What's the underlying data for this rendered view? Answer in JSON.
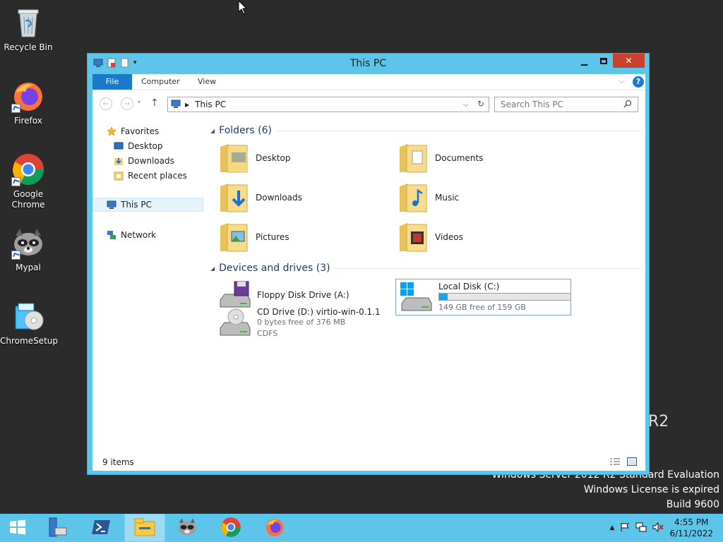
{
  "desktop": {
    "icons": [
      {
        "label": "Recycle Bin"
      },
      {
        "label": "Firefox"
      },
      {
        "label": "Google Chrome"
      },
      {
        "label": "Mypal"
      },
      {
        "label": "ChromeSetup"
      }
    ],
    "watermark": {
      "r2": "R2",
      "edition": "Windows Server 2012 R2 Standard Evaluation",
      "license": "Windows License is expired",
      "build": "Build 9600"
    }
  },
  "window": {
    "title": "This PC",
    "ribbon_tabs": [
      "File",
      "Computer",
      "View"
    ],
    "address": {
      "path": "This PC"
    },
    "search": {
      "placeholder": "Search This PC"
    },
    "nav_pane": {
      "favorites": "Favorites",
      "fav_items": [
        "Desktop",
        "Downloads",
        "Recent places"
      ],
      "this_pc": "This PC",
      "network": "Network"
    },
    "folders_group": "Folders (6)",
    "folders": [
      "Desktop",
      "Documents",
      "Downloads",
      "Music",
      "Pictures",
      "Videos"
    ],
    "drives_group": "Devices and drives (3)",
    "drives": {
      "floppy": {
        "name": "Floppy Disk Drive (A:)"
      },
      "local": {
        "name": "Local Disk (C:)",
        "free": "149 GB free of 159 GB",
        "used_fraction": 0.063
      },
      "cd": {
        "name": "CD Drive (D:) virtio-win-0.1.1",
        "free": "0 bytes free of 376 MB",
        "fs": "CDFS"
      }
    },
    "status": "9 items"
  },
  "taskbar": {
    "clock_time": "4:55 PM",
    "clock_date": "6/11/2022"
  },
  "colors": {
    "accent": "#5ec5ea",
    "file_tab": "#1979ca",
    "close": "#c7432f",
    "disk_bar": "#26a0da"
  }
}
